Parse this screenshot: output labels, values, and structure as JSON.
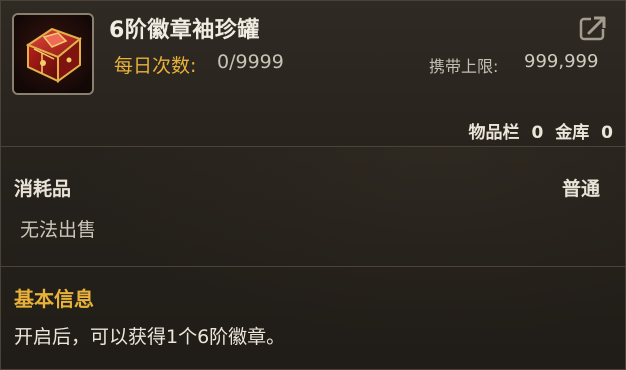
{
  "item": {
    "name": "6阶徽章袖珍罐",
    "icon": "red-gem-chest-icon"
  },
  "header": {
    "daily_label": "每日次数:",
    "daily_value": "0/9999",
    "carry_label": "携带上限:",
    "carry_value": "999,999",
    "inventory_label": "物品栏",
    "inventory_count": "0",
    "vault_label": "金库",
    "vault_count": "0",
    "share_icon": "share-icon"
  },
  "properties": {
    "category": "消耗品",
    "grade": "普通",
    "trade": "无法出售"
  },
  "info": {
    "title": "基本信息",
    "description": "开启后，可以获得1个6阶徽章。"
  },
  "colors": {
    "accent": "#e8b23a",
    "text": "#ece6da",
    "background": "#24201a"
  }
}
